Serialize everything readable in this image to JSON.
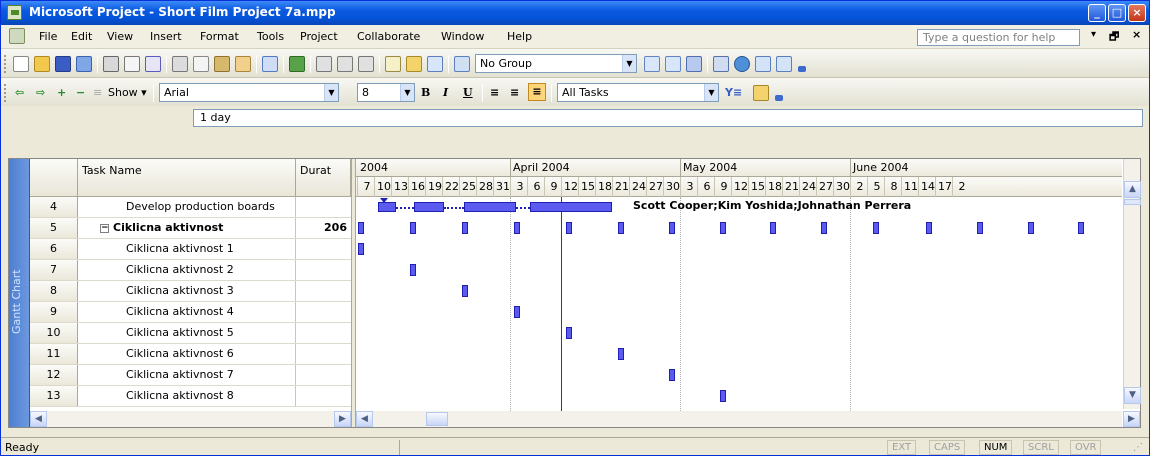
{
  "window": {
    "title": "Microsoft Project - Short Film Project 7a.mpp"
  },
  "menu": {
    "items": [
      "File",
      "Edit",
      "View",
      "Insert",
      "Format",
      "Tools",
      "Project",
      "Collaborate",
      "Window",
      "Help"
    ],
    "help_placeholder": "Type a question for help"
  },
  "toolbar1": {
    "group_value": "No Group"
  },
  "toolbar2": {
    "show_label": "Show",
    "font_value": "Arial",
    "size_value": "8",
    "filter_value": "All Tasks"
  },
  "entry": {
    "value": "1 day"
  },
  "view_bar": {
    "label": "Gantt Chart"
  },
  "table": {
    "headers": {
      "task_name": "Task Name",
      "duration": "Durat"
    },
    "rows": [
      {
        "id": "4",
        "name": "Develop production boards",
        "duration": "",
        "summary": false
      },
      {
        "id": "5",
        "name": "Ciklicna aktivnost",
        "duration": "206",
        "summary": true
      },
      {
        "id": "6",
        "name": "Ciklicna aktivnost 1",
        "duration": "",
        "summary": false
      },
      {
        "id": "7",
        "name": "Ciklicna aktivnost 2",
        "duration": "",
        "summary": false
      },
      {
        "id": "8",
        "name": "Ciklicna aktivnost 3",
        "duration": "",
        "summary": false
      },
      {
        "id": "9",
        "name": "Ciklicna aktivnost 4",
        "duration": "",
        "summary": false
      },
      {
        "id": "10",
        "name": "Ciklicna aktivnost 5",
        "duration": "",
        "summary": false
      },
      {
        "id": "11",
        "name": "Ciklicna aktivnost 6",
        "duration": "",
        "summary": false
      },
      {
        "id": "12",
        "name": "Ciklicna aktivnost 7",
        "duration": "",
        "summary": false
      },
      {
        "id": "13",
        "name": "Ciklicna aktivnost 8",
        "duration": "",
        "summary": false
      }
    ]
  },
  "gantt": {
    "months": [
      "2004",
      "April 2004",
      "May 2004",
      "June 2004"
    ],
    "days": [
      "7",
      "10",
      "13",
      "16",
      "19",
      "22",
      "25",
      "28",
      "31",
      "3",
      "6",
      "9",
      "12",
      "15",
      "18",
      "21",
      "24",
      "27",
      "30",
      "3",
      "6",
      "9",
      "12",
      "15",
      "18",
      "21",
      "24",
      "27",
      "30",
      "2",
      "5",
      "8",
      "11",
      "14",
      "17",
      "2"
    ],
    "resources": "Scott Cooper;Kim Yoshida;Johnathan Perrera"
  },
  "status": {
    "ready": "Ready",
    "indicators": [
      "EXT",
      "CAPS",
      "NUM",
      "SCRL",
      "OVR"
    ],
    "active": "NUM"
  }
}
